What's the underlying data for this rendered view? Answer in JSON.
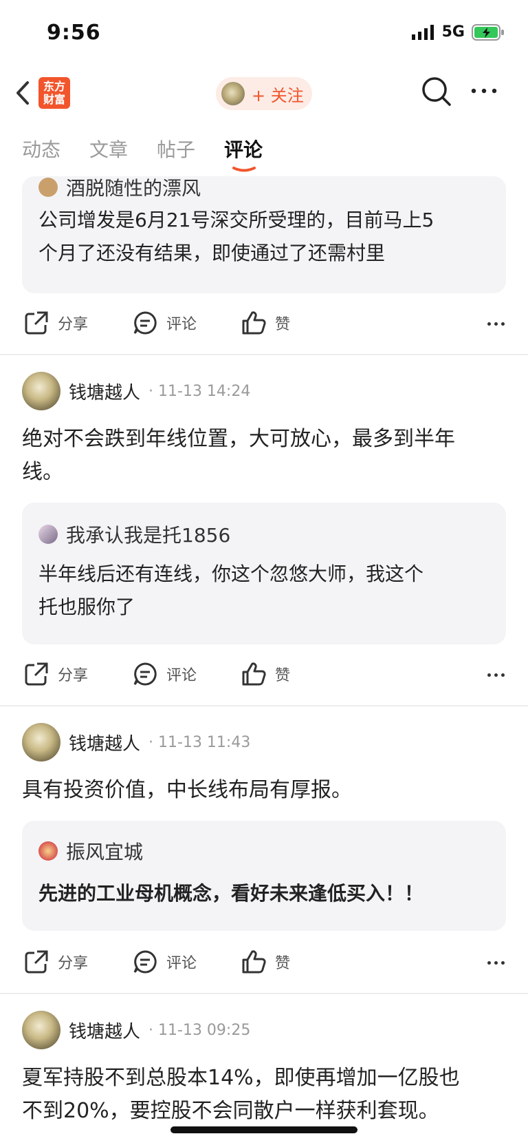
{
  "status": {
    "time": "9:56",
    "network": "5G"
  },
  "header": {
    "logo_line1": "东方",
    "logo_line2": "财富",
    "follow_label": "+ 关注"
  },
  "tabs": [
    "动态",
    "文章",
    "帖子",
    "评论"
  ],
  "actions": {
    "share": "分享",
    "comment": "评论",
    "like": "赞"
  },
  "top_quote": {
    "name": "酒脱随性的漂风",
    "text_line1": "公司增发是6月21号深交所受理的，目前马上5",
    "text_line2": "个月了还没有结果，即使通过了还需村里"
  },
  "posts": [
    {
      "author": "钱塘越人",
      "time": "11-13 14:24",
      "text_line1": "绝对不会跌到年线位置，大可放心，最多到半年",
      "text_line2": "线。",
      "quote_name": "我承认我是托1856",
      "quote_line1": "半年线后还有连线，你这个忽悠大师，我这个",
      "quote_line2": "托也服你了"
    },
    {
      "author": "钱塘越人",
      "time": "11-13 11:43",
      "text_line1": "具有投资价值，中长线布局有厚报。",
      "quote_name": "振风宜城",
      "quote_line1": "先进的工业母机概念，看好未来逢低买入！！"
    },
    {
      "author": "钱塘越人",
      "time": "11-13 09:25",
      "text_line1": "夏军持股不到总股本14%，即使再增加一亿股也",
      "text_line2": "不到20%，要控股不会同散户一样获利套现。"
    }
  ],
  "colors": {
    "accent": "#f2552c",
    "follow_bg": "#fdece6",
    "quote_bg": "#f4f4f7",
    "battery": "#34c759"
  }
}
